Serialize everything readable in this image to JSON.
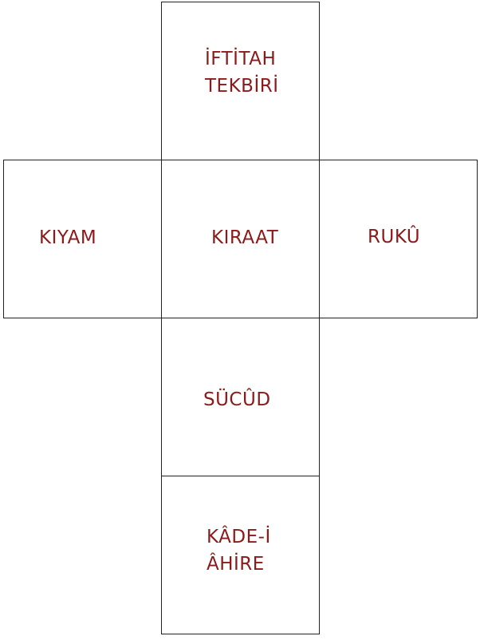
{
  "boxes": {
    "top": "İFTİTAH\nTEKBİRİ",
    "left": "KIYAM",
    "center": "KIRAAT",
    "right": "RUKÛ",
    "bottom1": "SÜCÛD",
    "bottom2": "KÂDE-İ\nÂHİRE"
  },
  "colors": {
    "text": "#8b1a1a",
    "border": "#222222"
  }
}
